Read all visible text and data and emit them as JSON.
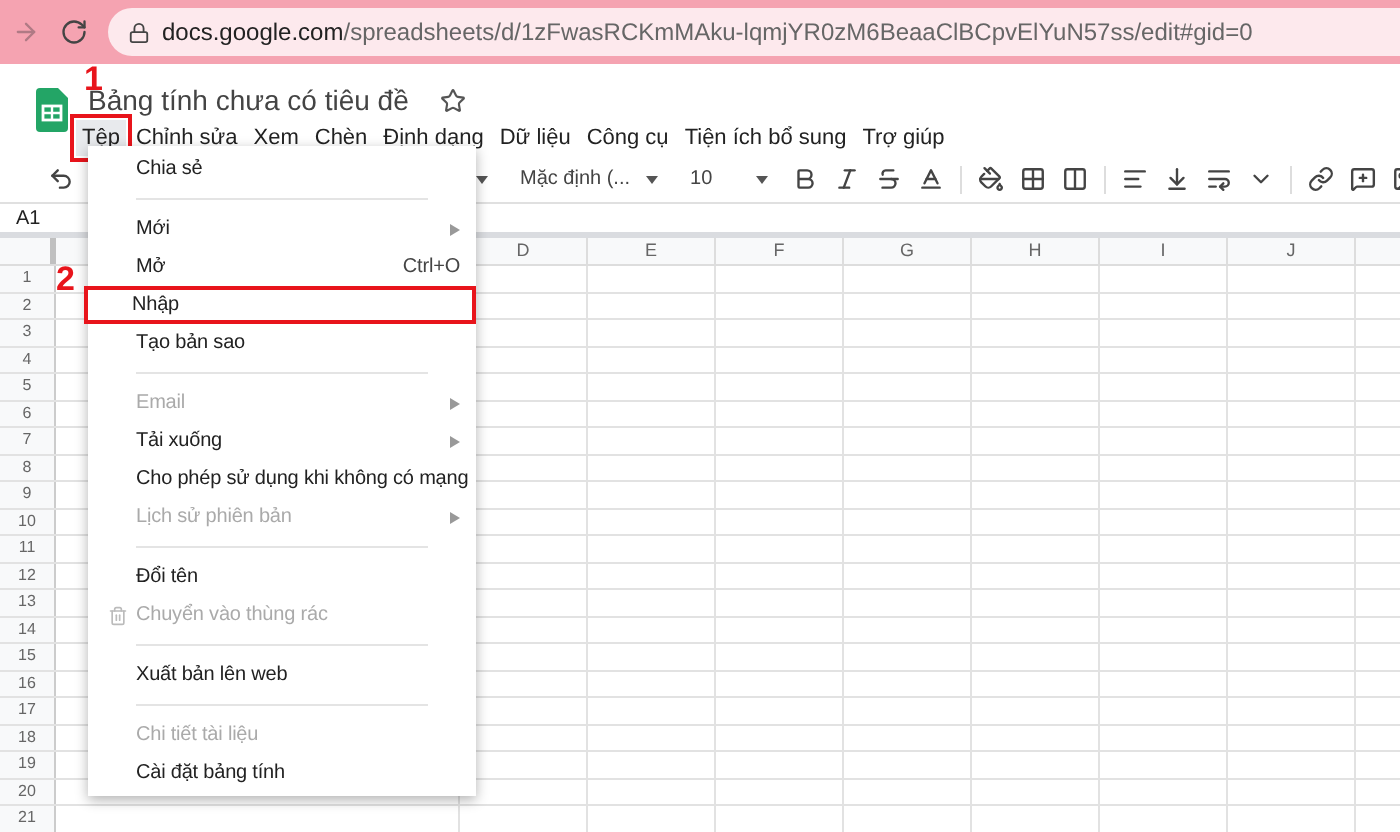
{
  "browser": {
    "url_host": "docs.google.com",
    "url_path": "/spreadsheets/d/1zFwasRCKmMAku-lqmjYR0zM6BeaaClBCpvElYuN57ss/edit#gid=0"
  },
  "document": {
    "title": "Bảng tính chưa có tiêu đề"
  },
  "menubar": [
    {
      "label": "Tệp",
      "selected": true,
      "marked": true
    },
    {
      "label": "Chỉnh sửa",
      "selected": false,
      "marked": false
    },
    {
      "label": "Xem",
      "selected": false,
      "marked": false
    },
    {
      "label": "Chèn",
      "selected": false,
      "marked": false
    },
    {
      "label": "Định dạng",
      "selected": false,
      "marked": false
    },
    {
      "label": "Dữ liệu",
      "selected": false,
      "marked": false
    },
    {
      "label": "Công cụ",
      "selected": false,
      "marked": false
    },
    {
      "label": "Tiện ích bổ sung",
      "selected": false,
      "marked": false
    },
    {
      "label": "Trợ giúp",
      "selected": false,
      "marked": false
    }
  ],
  "toolbar": {
    "font": "Mặc định (...",
    "font_size": "10"
  },
  "name_box": "A1",
  "columns": [
    "D",
    "E",
    "F",
    "G",
    "H",
    "I",
    "J"
  ],
  "rows": [
    "1",
    "2",
    "3",
    "4",
    "5",
    "6",
    "7",
    "8",
    "9",
    "10",
    "11",
    "12",
    "13",
    "14",
    "15",
    "16",
    "17",
    "18",
    "19",
    "20",
    "21"
  ],
  "file_menu": [
    {
      "kind": "item",
      "label": "Chia sẻ",
      "disabled": false,
      "submenu": false,
      "marked": false
    },
    {
      "kind": "separator"
    },
    {
      "kind": "item",
      "label": "Mới",
      "disabled": false,
      "submenu": true,
      "marked": false
    },
    {
      "kind": "item",
      "label": "Mở",
      "shortcut": "Ctrl+O",
      "disabled": false,
      "submenu": false,
      "marked": false
    },
    {
      "kind": "item",
      "label": "Nhập",
      "disabled": false,
      "submenu": false,
      "marked": true
    },
    {
      "kind": "item",
      "label": "Tạo bản sao",
      "disabled": false,
      "submenu": false,
      "marked": false
    },
    {
      "kind": "separator"
    },
    {
      "kind": "item",
      "label": "Email",
      "disabled": true,
      "submenu": true,
      "marked": false
    },
    {
      "kind": "item",
      "label": "Tải xuống",
      "disabled": false,
      "submenu": true,
      "marked": false
    },
    {
      "kind": "item",
      "label": "Cho phép sử dụng khi không có mạng",
      "disabled": false,
      "submenu": false,
      "marked": false
    },
    {
      "kind": "item",
      "label": "Lịch sử phiên bản",
      "disabled": true,
      "submenu": true,
      "marked": false
    },
    {
      "kind": "separator"
    },
    {
      "kind": "item",
      "label": "Đổi tên",
      "disabled": false,
      "submenu": false,
      "marked": false
    },
    {
      "kind": "item",
      "label": "Chuyển vào thùng rác",
      "disabled": true,
      "submenu": false,
      "marked": false,
      "trash": true
    },
    {
      "kind": "separator"
    },
    {
      "kind": "item",
      "label": "Xuất bản lên web",
      "disabled": false,
      "submenu": false,
      "marked": false
    },
    {
      "kind": "separator"
    },
    {
      "kind": "item",
      "label": "Chi tiết tài liệu",
      "disabled": true,
      "submenu": false,
      "marked": false
    },
    {
      "kind": "item",
      "label": "Cài đặt bảng tính",
      "disabled": false,
      "submenu": false,
      "marked": false
    }
  ],
  "step_labels": [
    "1",
    "2"
  ]
}
